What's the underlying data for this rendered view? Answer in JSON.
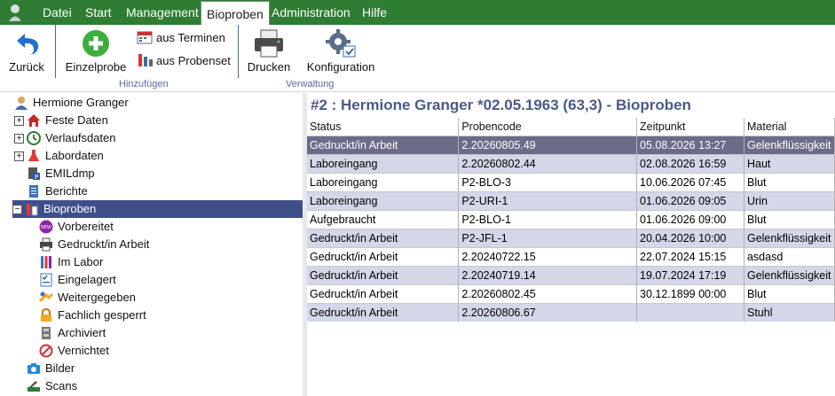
{
  "menu": {
    "items": [
      "Datei",
      "Start",
      "Management",
      "Bioproben",
      "Administration",
      "Hilfe"
    ],
    "active": "Bioproben"
  },
  "ribbon": {
    "back": "Zurück",
    "single_sample": "Einzelprobe",
    "from_appointments": "aus Terminen",
    "from_sample_set": "aus Probenset",
    "group_add": "Hinzufügen",
    "print": "Drucken",
    "configuration": "Konfiguration",
    "group_admin": "Verwaltung"
  },
  "tree": {
    "patient": "Hermione Granger",
    "items": [
      {
        "label": "Feste Daten",
        "expand": "+"
      },
      {
        "label": "Verlaufsdaten",
        "expand": "+"
      },
      {
        "label": "Labordaten",
        "expand": "+"
      },
      {
        "label": "EMILdmp",
        "expand": ""
      },
      {
        "label": "Berichte",
        "expand": ""
      },
      {
        "label": "Bioproben",
        "expand": "−"
      }
    ],
    "subitems": [
      "Vorbereitet",
      "Gedruckt/in Arbeit",
      "Im Labor",
      "Eingelagert",
      "Weitergegeben",
      "Fachlich gesperrt",
      "Archiviert",
      "Vernichtet"
    ],
    "tail": [
      "Bilder",
      "Scans"
    ]
  },
  "content": {
    "title": "#2 : Hermione Granger *02.05.1963 (63,3) - Bioproben",
    "columns": [
      "Status",
      "Probencode",
      "Zeitpunkt",
      "Material"
    ],
    "rows": [
      [
        "Gedruckt/in Arbeit",
        "2.20260805.49",
        "05.08.2026 13:27",
        "Gelenkflüssigkeit"
      ],
      [
        "Laboreingang",
        "2.20260802.44",
        "02.08.2026 16:59",
        "Haut"
      ],
      [
        "Laboreingang",
        "P2-BLO-3",
        "10.06.2026 07:45",
        "Blut"
      ],
      [
        "Laboreingang",
        "P2-URI-1",
        "01.06.2026 09:05",
        "Urin"
      ],
      [
        "Aufgebraucht",
        "P2-BLO-1",
        "01.06.2026 09:00",
        "Blut"
      ],
      [
        "Gedruckt/in Arbeit",
        "P2-JFL-1",
        "20.04.2026 10:00",
        "Gelenkflüssigkeit"
      ],
      [
        "Gedruckt/in Arbeit",
        "2.20240722.15",
        "22.07.2024 15:15",
        "asdasd"
      ],
      [
        "Gedruckt/in Arbeit",
        "2.20240719.14",
        "19.07.2024 17:19",
        "Gelenkflüssigkeit"
      ],
      [
        "Gedruckt/in Arbeit",
        "2.20260802.45",
        "30.12.1899 00:00",
        "Blut"
      ],
      [
        "Gedruckt/in Arbeit",
        "2.20260806.67",
        "",
        "Stuhl"
      ]
    ]
  }
}
